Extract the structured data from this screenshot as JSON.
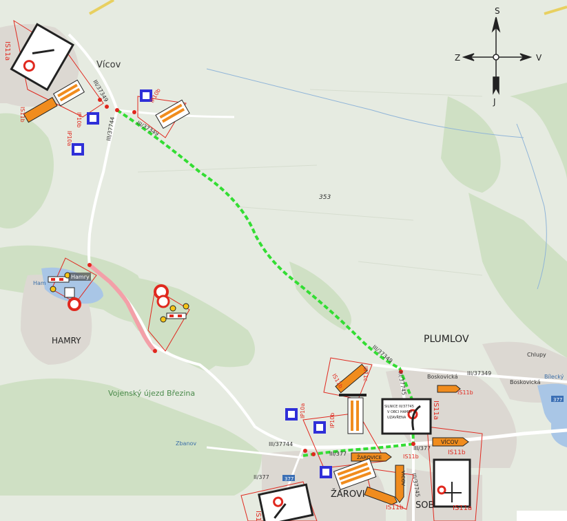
{
  "compass": {
    "north": "S",
    "east": "V",
    "south": "J",
    "west": "Z"
  },
  "places": {
    "vicov": "Vícov",
    "plumlov": "PLUMLOV",
    "hamry": "HAMRY",
    "zarovice": "ŽAROVI",
    "soběsuky": "SOB",
    "vojensky": "Vojenský újezd Březina",
    "hamry_lake": "Hamry I",
    "hamry_small": "Ham",
    "zbanov": "Zbanov",
    "boskovicka1": "Boskovická",
    "boskovicka2": "Boskovická",
    "chlupy": "Chlupy",
    "bilecky": "Bílecký"
  },
  "roads": {
    "r37349_top": "III/37349",
    "r37349_mid": "III/37349",
    "r37349_right": "III/37349",
    "r37349_plumlov": "III/37349",
    "r37744_top": "III/37744",
    "r37744_bottom": "III/37744",
    "r37745_a": "III/37745",
    "r37745_b": "III/37745",
    "r377_a": "III/377",
    "r377_b": "III/377",
    "r377_c": "II/377",
    "shield_377a": "377",
    "shield_377b": "377",
    "spot_height": "353"
  },
  "signs": {
    "is11a_top": "IS11a",
    "is11b_top": "IS11b",
    "ip10a_top": "IP10a",
    "ip10b_top": "IP10b",
    "ip10b_mid": "IP10b",
    "is11a_mid": "IS11a",
    "is11b_mid": "IS11b",
    "is11c_mid": "IS11c",
    "ip10a_bottom": "IP10a",
    "ip10b_bottom": "IP10b",
    "ip10b_low": "IP10b",
    "is11b_plumlov": "IS11b",
    "is11b_r": "IS11b",
    "is11b_low": "IS11b",
    "is11a_bottom": "IS11a",
    "is11a_right": "IS11a",
    "is11b_soc": "IS11b",
    "vicov_dir": "VÍCOV",
    "zarovice_dir": "ŽAROVICE",
    "vicov_vert": "VÍCOV",
    "zarovice_small": "ŽAROVICE"
  },
  "notice": {
    "line1": "SILNICE III/37745",
    "line2": "V OBCI HAMRY",
    "line3": "UZAVŘENA"
  },
  "colors": {
    "detour": "#33dd33",
    "closure": "#f3a0a8",
    "sign_orange": "#f08c1e",
    "sign_blue": "#2f2fd8",
    "water": "#a9c6e6",
    "frame_red": "#e0281e"
  }
}
